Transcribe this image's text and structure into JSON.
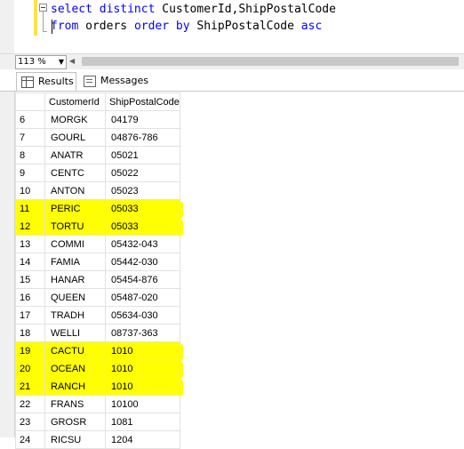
{
  "editor": {
    "line1": {
      "select": "select",
      "distinct": "distinct",
      "col1": "CustomerId",
      "comma": ",",
      "col2": "ShipPostalCode"
    },
    "line2": {
      "from": "from",
      "table": "orders",
      "order": "order",
      "by": "by",
      "col": "ShipPostalCode",
      "asc": "asc"
    }
  },
  "zoom": {
    "value": "113 %"
  },
  "tabs": {
    "results": "Results",
    "messages": "Messages"
  },
  "grid": {
    "columns": [
      "CustomerId",
      "ShipPostalCode"
    ],
    "highlight_color": "#ffff00",
    "rows": [
      {
        "n": "6",
        "customer": "MORGK",
        "postal": "04179",
        "highlighted": false
      },
      {
        "n": "7",
        "customer": "GOURL",
        "postal": "04876-786",
        "highlighted": false
      },
      {
        "n": "8",
        "customer": "ANATR",
        "postal": "05021",
        "highlighted": false
      },
      {
        "n": "9",
        "customer": "CENTC",
        "postal": "05022",
        "highlighted": false
      },
      {
        "n": "10",
        "customer": "ANTON",
        "postal": "05023",
        "highlighted": false
      },
      {
        "n": "11",
        "customer": "PERIC",
        "postal": "05033",
        "highlighted": true
      },
      {
        "n": "12",
        "customer": "TORTU",
        "postal": "05033",
        "highlighted": true
      },
      {
        "n": "13",
        "customer": "COMMI",
        "postal": "05432-043",
        "highlighted": false
      },
      {
        "n": "14",
        "customer": "FAMIA",
        "postal": "05442-030",
        "highlighted": false
      },
      {
        "n": "15",
        "customer": "HANAR",
        "postal": "05454-876",
        "highlighted": false
      },
      {
        "n": "16",
        "customer": "QUEEN",
        "postal": "05487-020",
        "highlighted": false
      },
      {
        "n": "17",
        "customer": "TRADH",
        "postal": "05634-030",
        "highlighted": false
      },
      {
        "n": "18",
        "customer": "WELLI",
        "postal": "08737-363",
        "highlighted": false
      },
      {
        "n": "19",
        "customer": "CACTU",
        "postal": "1010",
        "highlighted": true
      },
      {
        "n": "20",
        "customer": "OCEAN",
        "postal": "1010",
        "highlighted": true
      },
      {
        "n": "21",
        "customer": "RANCH",
        "postal": "1010",
        "highlighted": true
      },
      {
        "n": "22",
        "customer": "FRANS",
        "postal": "10100",
        "highlighted": false
      },
      {
        "n": "23",
        "customer": "GROSR",
        "postal": "1081",
        "highlighted": false
      },
      {
        "n": "24",
        "customer": "RICSU",
        "postal": "1204",
        "highlighted": false
      }
    ]
  }
}
